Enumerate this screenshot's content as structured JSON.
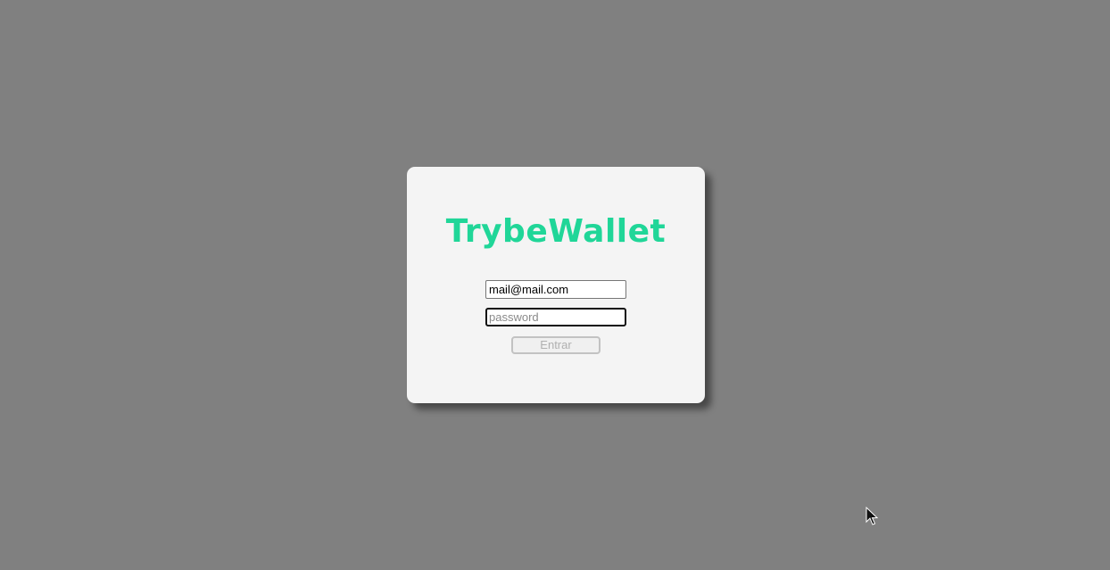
{
  "app": {
    "title": "TrybeWallet"
  },
  "colors": {
    "background": "#808080",
    "card": "#f4f4f4",
    "brand": "#20d698"
  },
  "login": {
    "email": {
      "value": "mail@mail.com",
      "placeholder": ""
    },
    "password": {
      "value": "",
      "placeholder": "password"
    },
    "submit_label": "Entrar",
    "submit_disabled": true
  },
  "icons": {
    "cursor": "mouse-pointer-icon"
  }
}
